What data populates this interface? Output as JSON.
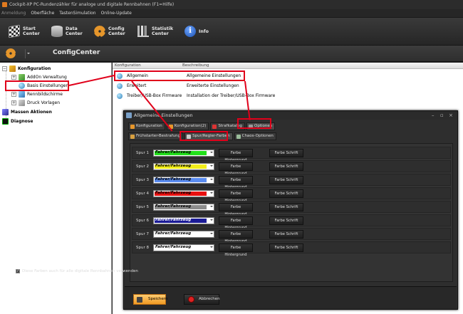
{
  "window": {
    "title": "Cockpit-XP PC-Rundenzähler für analoge und digitale Rennbahnen (F1=Hilfe)"
  },
  "menu": [
    {
      "label": "Anmeldung",
      "disabled": true
    },
    {
      "label": "Oberfläche",
      "disabled": false
    },
    {
      "label": "TastenSimulation",
      "disabled": false
    },
    {
      "label": "Online-Update",
      "disabled": false
    }
  ],
  "toolbar": {
    "start": {
      "line1": "Start",
      "line2": "Center",
      "icon": "checkered-flag-icon"
    },
    "data": {
      "line1": "Data",
      "line2": "Center",
      "icon": "database-icon"
    },
    "config": {
      "line1": "Config",
      "line2": "Center",
      "icon": "gear-icon"
    },
    "statistik": {
      "line1": "Statistik",
      "line2": "Center",
      "icon": "chart-icon"
    },
    "info": {
      "label": "Info",
      "icon": "info-icon"
    }
  },
  "center_title": "ConfigCenter",
  "tree": {
    "root": "Konfiguration",
    "items": [
      "AddOn Verwaltung",
      "Basis Einstellungen",
      "Rennbildschirme",
      "Druck Vorlagen"
    ],
    "massen": "Massen Aktionen",
    "diagnose": "Diagnose"
  },
  "list": {
    "headers": [
      "Konfiguration",
      "Beschreibung"
    ],
    "rows": [
      {
        "name": "Allgemein",
        "desc": "Allgemeine Einstellungen"
      },
      {
        "name": "Erweitert",
        "desc": "Erweiterte Einstellungen"
      },
      {
        "name": "Treiber/USB-Box Firmware",
        "desc": "Installation der Treiber/USB-Box Firmware"
      }
    ]
  },
  "dialog": {
    "title": "Allgemeine Einstellungen",
    "controls": {
      "minimize": "–",
      "restore": "▫",
      "close": "×"
    },
    "tabs": [
      "Konfiguration",
      "Konfiguration(2)",
      "Strafkatalog",
      "Optionen"
    ],
    "subtabs": [
      "Frühstarter-Bestrafung",
      "Spur/Regler-Farben",
      "Chaos-Optionen"
    ],
    "combo_text": "Fahrer/Fahrzeug",
    "btn_bg": "Farbe Hintergrund",
    "btn_font": "Farbe Schrift",
    "lanes": [
      {
        "label": "Spur 1",
        "color": "#22e01a"
      },
      {
        "label": "Spur 2",
        "color": "#f2ee1a"
      },
      {
        "label": "Spur 3",
        "color": "#5a8cf0"
      },
      {
        "label": "Spur 4",
        "color": "#e81010"
      },
      {
        "label": "Spur 5",
        "color": "#8c8c8c"
      },
      {
        "label": "Spur 6",
        "color": "#1b1b96"
      },
      {
        "label": "Spur 7",
        "color": "#ffffff"
      },
      {
        "label": "Spur 8",
        "color": "#ffffff"
      }
    ],
    "checkbox": {
      "label": "Diese Farben auch für alle digitale Rennbahnen verwenden",
      "checked": true
    },
    "save": "Speichern",
    "cancel": "Abbrechen"
  },
  "colors": {
    "highlight": "#e0001a",
    "accent": "#f09a24"
  }
}
